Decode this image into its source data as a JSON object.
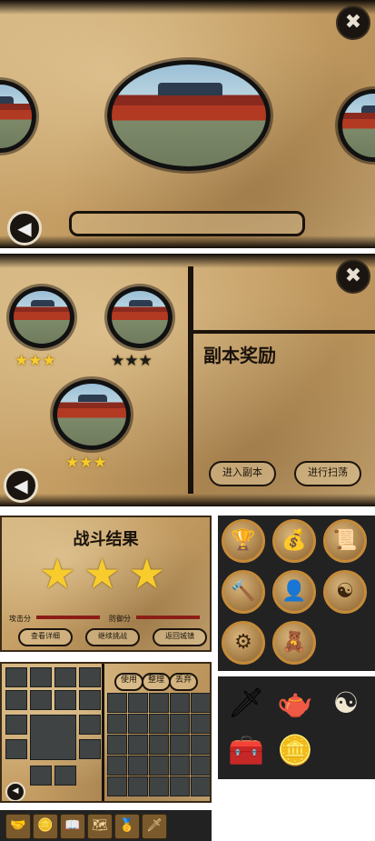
{
  "panel1": {
    "close_icon": "✖",
    "back_icon": "◀"
  },
  "panel2": {
    "close_icon": "✖",
    "back_icon": "◀",
    "reward_title": "副本奖励",
    "enter_button": "进入副本",
    "sweep_button": "进行扫荡",
    "stages": [
      {
        "stars": 3,
        "earned": true
      },
      {
        "stars": 3,
        "earned": false
      },
      {
        "stars": 3,
        "earned": true
      }
    ]
  },
  "battle_result": {
    "title": "战斗结果",
    "stars": 3,
    "attack_label": "攻击分",
    "defense_label": "防御分",
    "buttons": [
      "查看详细",
      "继续挑战",
      "返回城镇"
    ]
  },
  "skill_icons": [
    {
      "name": "chalice-icon",
      "glyph": "🏆"
    },
    {
      "name": "money-bag-icon",
      "glyph": "💰"
    },
    {
      "name": "scroll-icon",
      "glyph": "📜"
    },
    {
      "name": "hammer-icon",
      "glyph": "🔨"
    },
    {
      "name": "character-icon",
      "glyph": "👤"
    },
    {
      "name": "yin-yang-icon",
      "glyph": "☯"
    },
    {
      "name": "gears-icon",
      "glyph": "⚙"
    },
    {
      "name": "dolls-icon",
      "glyph": "🧸"
    }
  ],
  "items_panel": [
    {
      "name": "sword-shield-icon",
      "glyph": "🗡"
    },
    {
      "name": "teapot-icon",
      "glyph": "🫖"
    },
    {
      "name": "bagua-icon",
      "glyph": "☯"
    },
    {
      "name": "chest-icon",
      "glyph": "🧰"
    },
    {
      "name": "coins-icon",
      "glyph": "🪙"
    }
  ],
  "inventory": {
    "tabs": [
      "使用",
      "整理",
      "丢弃"
    ],
    "back_icon": "◀"
  },
  "toolbar": [
    {
      "name": "handshake-icon",
      "glyph": "🤝"
    },
    {
      "name": "coin-icon",
      "glyph": "🪙"
    },
    {
      "name": "book-icon",
      "glyph": "📖"
    },
    {
      "name": "map-icon",
      "glyph": "🗺"
    },
    {
      "name": "gold-ingot-icon",
      "glyph": "🥇"
    },
    {
      "name": "sword-icon",
      "glyph": "🗡"
    }
  ]
}
